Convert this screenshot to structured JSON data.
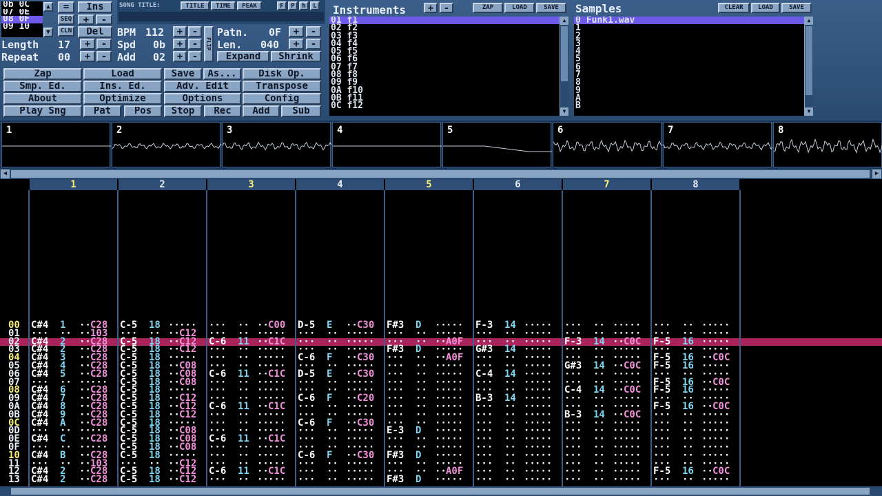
{
  "position": {
    "list": [
      "0b 0C",
      "07 0E",
      "08 0F",
      "09 10"
    ],
    "selected_index": 2
  },
  "ins_button": "Ins",
  "eq_button": "=",
  "seq_button": "SEQ",
  "cln_button": "CLN",
  "plus": "+",
  "minus": "-",
  "del_button": "Del",
  "length": {
    "label": "Length",
    "value": "17"
  },
  "repeat": {
    "label": "Repeat",
    "value": "00"
  },
  "bpm": {
    "label": "BPM",
    "value": "112"
  },
  "spd": {
    "label": "Spd",
    "value": "0b"
  },
  "add": {
    "label": "Add",
    "value": "02"
  },
  "flip": "FLIP",
  "patn": {
    "label": "Patn.",
    "value": "0F"
  },
  "len": {
    "label": "Len.",
    "value": "040"
  },
  "expand_button": "Expand",
  "shrink_button": "Shrink",
  "song_title": {
    "label": "SONG TITLE:",
    "title_tab": "TITLE",
    "time_tab": "TIME",
    "peak_tab": "PEAK",
    "f": "F",
    "p": "P",
    "h": "h",
    "l": "L",
    "value": ""
  },
  "main_buttons": [
    [
      "Zap",
      "Load",
      "Save",
      "As...",
      "Disk Op."
    ],
    [
      "Smp. Ed.",
      "Ins. Ed.",
      "Adv. Edit",
      "Transpose"
    ],
    [
      "About",
      "Optimize",
      "Options",
      "Config"
    ],
    [
      "Play Sng",
      "Pat",
      "Pos",
      "Stop",
      "Rec",
      "Add",
      "Sub"
    ]
  ],
  "instruments": {
    "title": "Instruments",
    "zap": "ZAP",
    "load": "LOAD",
    "save": "SAVE",
    "items": [
      "01 f1",
      "02 f2",
      "03 f3",
      "04 f4",
      "05 f5",
      "06 f6",
      "07 f7",
      "08 f8",
      "09 f9",
      "0A f10",
      "0B f11",
      "0C f12"
    ],
    "selected_index": 0
  },
  "samples": {
    "title": "Samples",
    "clear": "CLEAR",
    "load": "LOAD",
    "save": "SAVE",
    "indices": [
      "0",
      "1",
      "2",
      "3",
      "4",
      "5",
      "6",
      "7",
      "8",
      "9",
      "A",
      "B"
    ],
    "names": [
      "Funk1.wav",
      "",
      "",
      "",
      "",
      "",
      "",
      "",
      "",
      "",
      "",
      ""
    ],
    "selected_index": 0
  },
  "scopes": [
    "1",
    "2",
    "3",
    "4",
    "5",
    "6",
    "7",
    "8"
  ],
  "channels": [
    "1",
    "2",
    "3",
    "4",
    "5",
    "6",
    "7",
    "8"
  ],
  "highlight_channels": [
    "1",
    "3",
    "5",
    "7"
  ],
  "cursor_row": "02",
  "rows": [
    {
      "n": "00",
      "hl": true,
      "c": [
        [
          "C#4",
          "1",
          "",
          "C28"
        ],
        [
          "C-5",
          "18",
          "",
          ""
        ],
        [
          "···",
          "··",
          "",
          "C00"
        ],
        [
          "D-5",
          "E",
          "",
          "C30"
        ],
        [
          "F#3",
          "D",
          "",
          ""
        ],
        [
          "F-3",
          "14",
          "",
          ""
        ],
        [
          "···",
          "··",
          "",
          ""
        ],
        [
          "···",
          "··",
          "",
          ""
        ]
      ]
    },
    {
      "n": "01",
      "hl": false,
      "c": [
        [
          "···",
          "··",
          "",
          "103"
        ],
        [
          "···",
          "··",
          "",
          "C12"
        ],
        [
          "···",
          "··",
          "",
          ""
        ],
        [
          "···",
          "··",
          "",
          ""
        ],
        [
          "···",
          "··",
          "",
          ""
        ],
        [
          "···",
          "··",
          "",
          ""
        ],
        [
          "···",
          "··",
          "",
          ""
        ],
        [
          "···",
          "··",
          "",
          ""
        ]
      ]
    },
    {
      "n": "02",
      "hl": false,
      "c": [
        [
          "C#4",
          "2",
          "",
          "C28"
        ],
        [
          "C-5",
          "18",
          "",
          "C12"
        ],
        [
          "C-6",
          "11",
          "",
          "C1C"
        ],
        [
          "···",
          "··",
          "",
          ""
        ],
        [
          "···",
          "··",
          "",
          "A0F"
        ],
        [
          "···",
          "··",
          "",
          ""
        ],
        [
          "F-3",
          "14",
          "",
          "C0C"
        ],
        [
          "F-5",
          "16",
          "",
          ""
        ]
      ]
    },
    {
      "n": "03",
      "hl": false,
      "c": [
        [
          "C#4",
          "2",
          "",
          "C28"
        ],
        [
          "C-5",
          "18",
          "",
          "C12"
        ],
        [
          "···",
          "··",
          "",
          ""
        ],
        [
          "···",
          "··",
          "",
          ""
        ],
        [
          "F#3",
          "D",
          "",
          ""
        ],
        [
          "G#3",
          "14",
          "",
          ""
        ],
        [
          "···",
          "··",
          "",
          ""
        ],
        [
          "···",
          "··",
          "",
          ""
        ]
      ]
    },
    {
      "n": "04",
      "hl": true,
      "c": [
        [
          "C#4",
          "3",
          "",
          "C28"
        ],
        [
          "C-5",
          "18",
          "",
          ""
        ],
        [
          "···",
          "··",
          "",
          ""
        ],
        [
          "C-6",
          "F",
          "",
          "C30"
        ],
        [
          "···",
          "··",
          "",
          "A0F"
        ],
        [
          "···",
          "··",
          "",
          ""
        ],
        [
          "···",
          "··",
          "",
          ""
        ],
        [
          "F-5",
          "16",
          "",
          "C0C"
        ]
      ]
    },
    {
      "n": "05",
      "hl": false,
      "c": [
        [
          "C#4",
          "4",
          "",
          "C28"
        ],
        [
          "C-5",
          "18",
          "",
          "C08"
        ],
        [
          "···",
          "··",
          "",
          ""
        ],
        [
          "···",
          "··",
          "",
          ""
        ],
        [
          "···",
          "··",
          "",
          ""
        ],
        [
          "···",
          "··",
          "",
          ""
        ],
        [
          "G#3",
          "14",
          "",
          "C0C"
        ],
        [
          "F-5",
          "16",
          "",
          ""
        ]
      ]
    },
    {
      "n": "06",
      "hl": false,
      "c": [
        [
          "C#4",
          "5",
          "",
          "C28"
        ],
        [
          "C-5",
          "18",
          "",
          "C08"
        ],
        [
          "C-6",
          "11",
          "",
          "C1C"
        ],
        [
          "D-5",
          "E",
          "",
          "C30"
        ],
        [
          "···",
          "··",
          "",
          ""
        ],
        [
          "C-4",
          "14",
          "",
          ""
        ],
        [
          "···",
          "··",
          "",
          ""
        ],
        [
          "···",
          "··",
          "",
          ""
        ]
      ]
    },
    {
      "n": "07",
      "hl": false,
      "c": [
        [
          "···",
          "··",
          "",
          ""
        ],
        [
          "C-5",
          "18",
          "",
          "C08"
        ],
        [
          "···",
          "··",
          "",
          ""
        ],
        [
          "···",
          "··",
          "",
          ""
        ],
        [
          "···",
          "··",
          "",
          ""
        ],
        [
          "···",
          "··",
          "",
          ""
        ],
        [
          "···",
          "··",
          "",
          ""
        ],
        [
          "F-5",
          "16",
          "",
          "C0C"
        ]
      ]
    },
    {
      "n": "08",
      "hl": true,
      "c": [
        [
          "C#4",
          "6",
          "",
          "C28"
        ],
        [
          "C-5",
          "18",
          "",
          ""
        ],
        [
          "···",
          "··",
          "",
          ""
        ],
        [
          "···",
          "··",
          "",
          ""
        ],
        [
          "···",
          "··",
          "",
          ""
        ],
        [
          "···",
          "··",
          "",
          ""
        ],
        [
          "C-4",
          "14",
          "",
          "C0C"
        ],
        [
          "F-5",
          "16",
          "",
          ""
        ]
      ]
    },
    {
      "n": "09",
      "hl": false,
      "c": [
        [
          "C#4",
          "7",
          "",
          "C28"
        ],
        [
          "C-5",
          "18",
          "",
          "C12"
        ],
        [
          "···",
          "··",
          "",
          ""
        ],
        [
          "C-6",
          "F",
          "",
          "C20"
        ],
        [
          "···",
          "··",
          "",
          ""
        ],
        [
          "B-3",
          "14",
          "",
          ""
        ],
        [
          "···",
          "··",
          "",
          ""
        ],
        [
          "···",
          "··",
          "",
          ""
        ]
      ]
    },
    {
      "n": "0A",
      "hl": false,
      "c": [
        [
          "C#4",
          "8",
          "",
          "C28"
        ],
        [
          "C-5",
          "18",
          "",
          "C12"
        ],
        [
          "C-6",
          "11",
          "",
          "C1C"
        ],
        [
          "···",
          "··",
          "",
          ""
        ],
        [
          "···",
          "··",
          "",
          ""
        ],
        [
          "···",
          "··",
          "",
          ""
        ],
        [
          "···",
          "··",
          "",
          ""
        ],
        [
          "F-5",
          "16",
          "",
          "C0C"
        ]
      ]
    },
    {
      "n": "0B",
      "hl": false,
      "c": [
        [
          "C#4",
          "9",
          "",
          "C28"
        ],
        [
          "C-5",
          "18",
          "",
          "C12"
        ],
        [
          "···",
          "··",
          "",
          ""
        ],
        [
          "···",
          "··",
          "",
          ""
        ],
        [
          "···",
          "··",
          "",
          ""
        ],
        [
          "···",
          "··",
          "",
          ""
        ],
        [
          "B-3",
          "14",
          "",
          "C0C"
        ],
        [
          "···",
          "··",
          "",
          ""
        ]
      ]
    },
    {
      "n": "0C",
      "hl": true,
      "c": [
        [
          "C#4",
          "A",
          "",
          "C28"
        ],
        [
          "C-5",
          "18",
          "",
          ""
        ],
        [
          "···",
          "··",
          "",
          ""
        ],
        [
          "C-6",
          "F",
          "",
          "C30"
        ],
        [
          "···",
          "··",
          "",
          ""
        ],
        [
          "···",
          "··",
          "",
          ""
        ],
        [
          "···",
          "··",
          "",
          ""
        ],
        [
          "···",
          "··",
          "",
          ""
        ]
      ]
    },
    {
      "n": "0D",
      "hl": false,
      "c": [
        [
          "···",
          "··",
          "",
          ""
        ],
        [
          "C-5",
          "18",
          "",
          "C08"
        ],
        [
          "···",
          "··",
          "",
          ""
        ],
        [
          "···",
          "··",
          "",
          ""
        ],
        [
          "E-3",
          "D",
          "",
          ""
        ],
        [
          "···",
          "··",
          "",
          ""
        ],
        [
          "···",
          "··",
          "",
          ""
        ],
        [
          "···",
          "··",
          "",
          ""
        ]
      ]
    },
    {
      "n": "0E",
      "hl": false,
      "c": [
        [
          "C#4",
          "C",
          "",
          "C28"
        ],
        [
          "C-5",
          "18",
          "",
          "C08"
        ],
        [
          "C-6",
          "11",
          "",
          "C1C"
        ],
        [
          "···",
          "··",
          "",
          ""
        ],
        [
          "···",
          "··",
          "",
          ""
        ],
        [
          "···",
          "··",
          "",
          ""
        ],
        [
          "···",
          "··",
          "",
          ""
        ],
        [
          "···",
          "··",
          "",
          ""
        ]
      ]
    },
    {
      "n": "0F",
      "hl": false,
      "c": [
        [
          "···",
          "··",
          "",
          ""
        ],
        [
          "C-5",
          "18",
          "",
          "C08"
        ],
        [
          "···",
          "··",
          "",
          ""
        ],
        [
          "···",
          "··",
          "",
          ""
        ],
        [
          "···",
          "··",
          "",
          ""
        ],
        [
          "···",
          "··",
          "",
          ""
        ],
        [
          "···",
          "··",
          "",
          ""
        ],
        [
          "···",
          "··",
          "",
          ""
        ]
      ]
    },
    {
      "n": "10",
      "hl": true,
      "c": [
        [
          "C#4",
          "B",
          "",
          "C28"
        ],
        [
          "C-5",
          "18",
          "",
          ""
        ],
        [
          "···",
          "··",
          "",
          ""
        ],
        [
          "C-6",
          "F",
          "",
          "C30"
        ],
        [
          "F#3",
          "D",
          "",
          ""
        ],
        [
          "···",
          "··",
          "",
          ""
        ],
        [
          "···",
          "··",
          "",
          ""
        ],
        [
          "···",
          "··",
          "",
          ""
        ]
      ]
    },
    {
      "n": "11",
      "hl": false,
      "c": [
        [
          "···",
          "··",
          "",
          "103"
        ],
        [
          "···",
          "··",
          "",
          "C12"
        ],
        [
          "···",
          "··",
          "",
          ""
        ],
        [
          "···",
          "··",
          "",
          ""
        ],
        [
          "···",
          "··",
          "",
          ""
        ],
        [
          "···",
          "··",
          "",
          ""
        ],
        [
          "···",
          "··",
          "",
          ""
        ],
        [
          "···",
          "··",
          "",
          ""
        ]
      ]
    },
    {
      "n": "12",
      "hl": false,
      "c": [
        [
          "C#4",
          "2",
          "",
          "C28"
        ],
        [
          "C-5",
          "18",
          "",
          "C12"
        ],
        [
          "C-6",
          "11",
          "",
          "C1C"
        ],
        [
          "···",
          "··",
          "",
          ""
        ],
        [
          "···",
          "··",
          "",
          "A0F"
        ],
        [
          "···",
          "··",
          "",
          ""
        ],
        [
          "···",
          "··",
          "",
          ""
        ],
        [
          "F-5",
          "16",
          "",
          "C0C"
        ]
      ]
    },
    {
      "n": "13",
      "hl": false,
      "c": [
        [
          "C#4",
          "2",
          "",
          "C28"
        ],
        [
          "C-5",
          "18",
          "",
          "C12"
        ],
        [
          "···",
          "··",
          "",
          ""
        ],
        [
          "···",
          "··",
          "",
          ""
        ],
        [
          "F#3",
          "D",
          "",
          ""
        ],
        [
          "···",
          "··",
          "",
          ""
        ],
        [
          "···",
          "··",
          "",
          ""
        ],
        [
          "···",
          "··",
          "",
          ""
        ]
      ]
    }
  ]
}
